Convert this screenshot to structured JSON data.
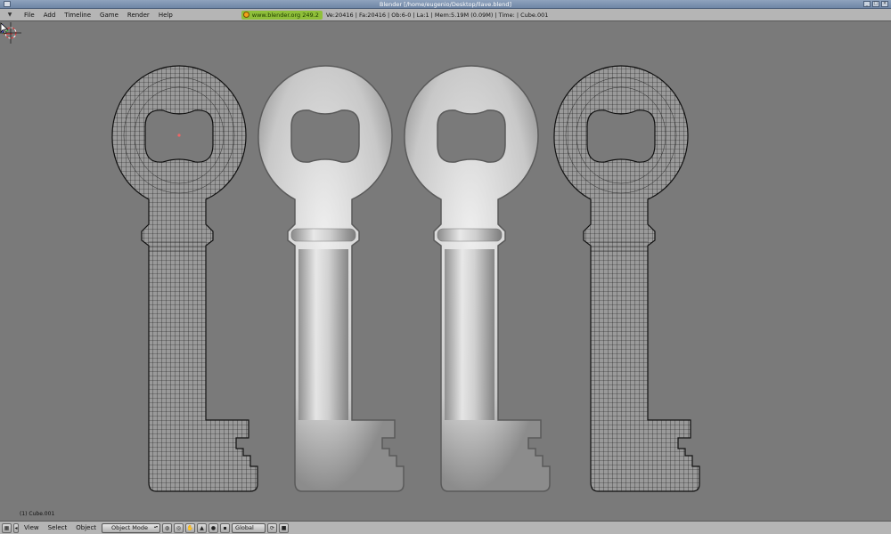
{
  "window": {
    "title": "Blender [/home/eugenio/Desktop/llave.blend]",
    "buttons": [
      "_",
      "□",
      "×"
    ]
  },
  "header": {
    "menus": [
      "File",
      "Add",
      "Timeline",
      "Game",
      "Render",
      "Help"
    ],
    "badge": "www.blender.org 249.2",
    "stats": "Ve:20416 | Fa:20416 | Ob:6-0 | La:1   | Mem:5.19M (0.09M)  | Time: | Cube.001"
  },
  "viewport": {
    "object_label": "(1) Cube.001",
    "background_color": "#7a7a7a",
    "keys": [
      "wireframe",
      "solid",
      "solid",
      "wireframe"
    ]
  },
  "footer": {
    "menus": [
      "View",
      "Select",
      "Object"
    ],
    "mode": "Object Mode",
    "orientation": "Global"
  }
}
